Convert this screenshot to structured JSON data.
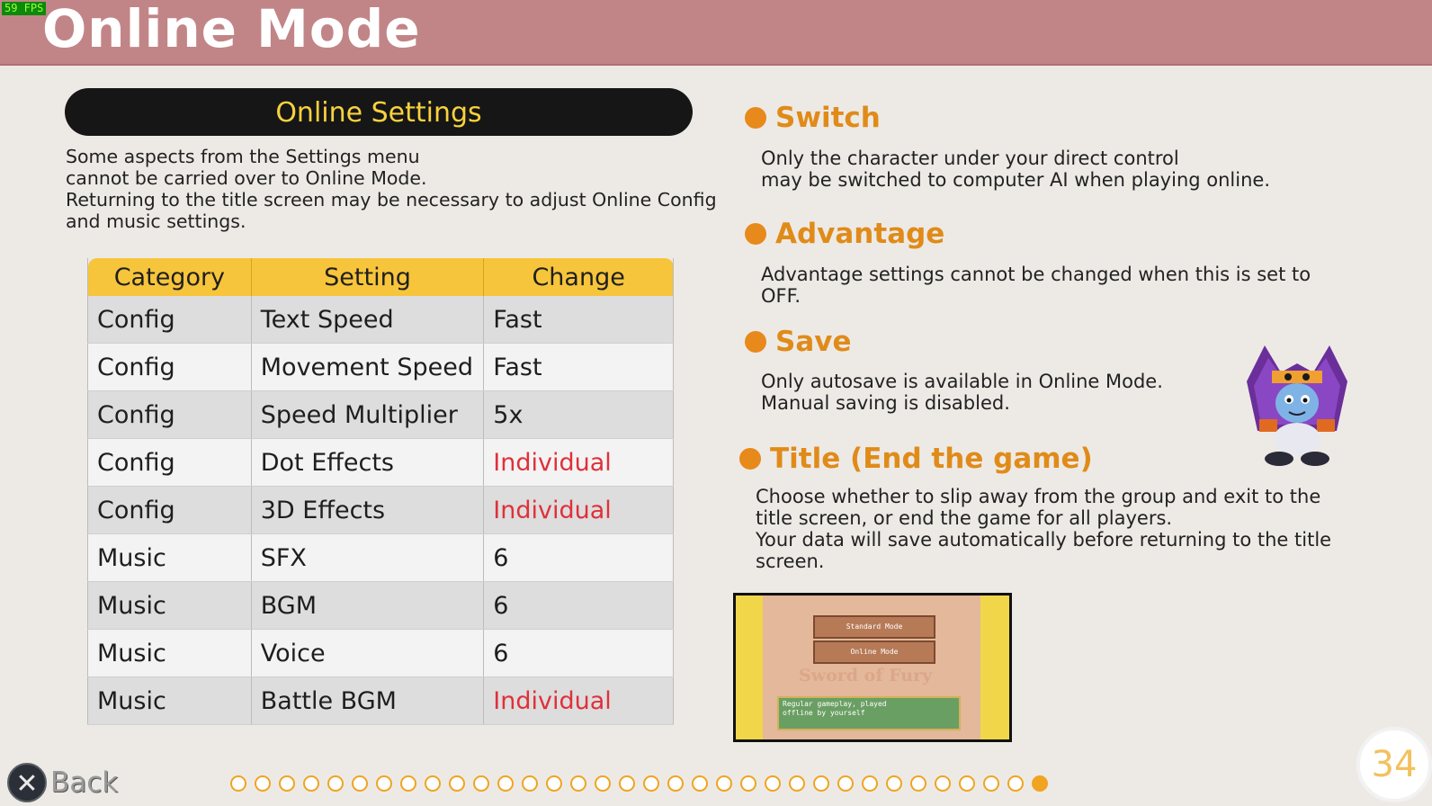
{
  "hud": {
    "fps": "59 FPS"
  },
  "header": {
    "title": "Online Mode"
  },
  "settings": {
    "heading": "Online Settings",
    "intro": [
      "Some aspects from the Settings menu",
      "cannot be carried over to Online Mode.",
      "Returning to the title screen may be necessary to adjust Online Config",
      "and music settings."
    ],
    "columns": [
      "Category",
      "Setting",
      "Change"
    ],
    "rows": [
      [
        "Config",
        "Text Speed",
        "Fast"
      ],
      [
        "Config",
        "Movement Speed",
        "Fast"
      ],
      [
        "Config",
        "Speed Multiplier",
        "5x"
      ],
      [
        "Config",
        "Dot Effects",
        "Individual"
      ],
      [
        "Config",
        "3D Effects",
        "Individual"
      ],
      [
        "Music",
        "SFX",
        "6"
      ],
      [
        "Music",
        "BGM",
        "6"
      ],
      [
        "Music",
        "Voice",
        "6"
      ],
      [
        "Music",
        "Battle BGM",
        "Individual"
      ]
    ],
    "highlight_color": "#e0303a"
  },
  "sections": {
    "switch": {
      "title": "Switch",
      "lines": [
        "Only the character under your direct control",
        "may be switched to computer AI when playing online."
      ]
    },
    "advantage": {
      "title": "Advantage",
      "lines": [
        "Advantage settings cannot be changed when this is set to",
        "OFF."
      ]
    },
    "save": {
      "title": "Save",
      "lines": [
        "Only autosave is available in Online Mode.",
        "Manual saving is disabled."
      ]
    },
    "title_end": {
      "title": "Title (End the game)",
      "lines": [
        "Choose whether to slip away from the group and exit to the",
        "title screen, or end the game for all players.",
        "Your data will save automatically before returning to the title",
        "screen."
      ]
    }
  },
  "screenshot": {
    "option1": "Standard Mode",
    "option2": "Online Mode",
    "logo": "Sword of Fury",
    "message": [
      "Regular gameplay, played",
      "offline by yourself"
    ]
  },
  "footer": {
    "back_label": "Back",
    "page_number": "34",
    "page_total": 34,
    "current_page": 34
  },
  "colors": {
    "accent": "#e8891c",
    "header": "#c28587",
    "table_header": "#f7c53b",
    "pill_text": "#f8d23e"
  }
}
